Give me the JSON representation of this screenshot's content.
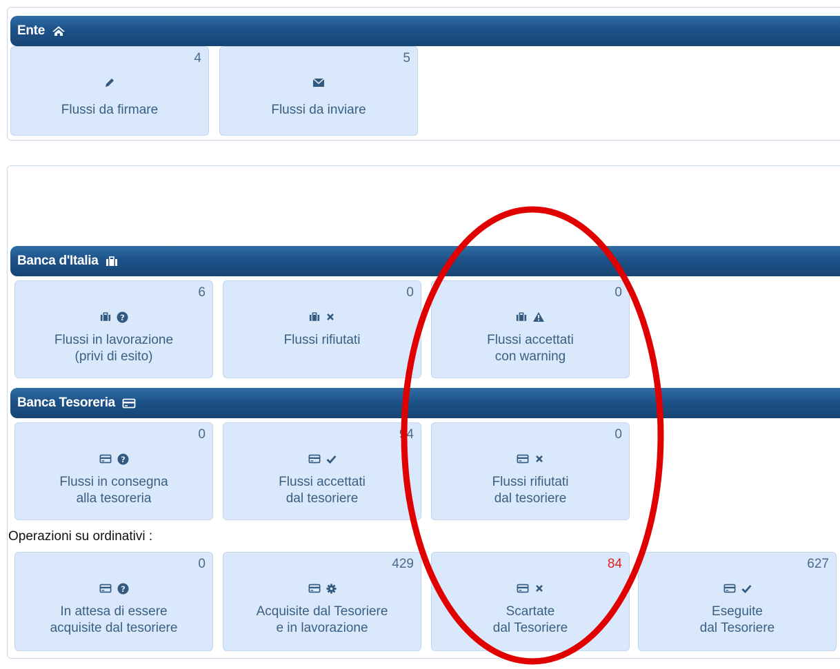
{
  "ente": {
    "title": "Ente",
    "icon": "home-icon",
    "tiles": [
      {
        "count": "4",
        "icons": [
          "pencil-icon"
        ],
        "label": "Flussi da firmare"
      },
      {
        "count": "5",
        "icons": [
          "envelope-icon"
        ],
        "label": "Flussi da inviare"
      }
    ]
  },
  "banca_italia": {
    "title": "Banca d'Italia",
    "icon": "briefcase-icon",
    "tiles": [
      {
        "count": "6",
        "icons": [
          "briefcase-icon",
          "question-circle-icon"
        ],
        "label_line1": "Flussi in lavorazione",
        "label_line2": "(privi di esito)"
      },
      {
        "count": "0",
        "icons": [
          "briefcase-icon",
          "times-icon"
        ],
        "label_line1": "Flussi rifiutati",
        "label_line2": ""
      },
      {
        "count": "0",
        "icons": [
          "briefcase-icon",
          "warning-icon"
        ],
        "label_line1": "Flussi accettati",
        "label_line2": "con warning"
      }
    ]
  },
  "banca_tesoreria": {
    "title": "Banca Tesoreria",
    "icon": "credit-card-icon",
    "tiles": [
      {
        "count": "0",
        "icons": [
          "credit-card-icon",
          "question-circle-icon"
        ],
        "label_line1": "Flussi in consegna",
        "label_line2": "alla tesoreria"
      },
      {
        "count": "94",
        "icons": [
          "credit-card-icon",
          "check-icon"
        ],
        "label_line1": "Flussi accettati",
        "label_line2": "dal tesoriere"
      },
      {
        "count": "0",
        "icons": [
          "credit-card-icon",
          "times-icon"
        ],
        "label_line1": "Flussi rifiutati",
        "label_line2": "dal tesoriere"
      }
    ]
  },
  "operazioni": {
    "title": "Operazioni su ordinativi :",
    "tiles": [
      {
        "count": "0",
        "icons": [
          "credit-card-icon",
          "question-circle-icon"
        ],
        "label_line1": "In attesa di essere",
        "label_line2": "acquisite dal tesoriere",
        "alert": false
      },
      {
        "count": "429",
        "icons": [
          "credit-card-icon",
          "cog-icon"
        ],
        "label_line1": "Acquisite dal Tesoriere",
        "label_line2": "e in lavorazione",
        "alert": false
      },
      {
        "count": "84",
        "icons": [
          "credit-card-icon",
          "times-icon"
        ],
        "label_line1": "Scartate",
        "label_line2": "dal Tesoriere",
        "alert": true
      },
      {
        "count": "627",
        "icons": [
          "credit-card-icon",
          "check-icon"
        ],
        "label_line1": "Eseguite",
        "label_line2": "dal Tesoriere",
        "alert": false
      }
    ]
  },
  "colors": {
    "header_bar": "#1d5289",
    "tile_bg": "#d9e8fa",
    "alert_count": "#e02020",
    "annotation": "#e00000"
  }
}
